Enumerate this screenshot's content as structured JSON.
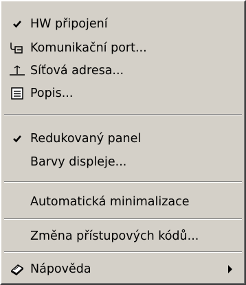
{
  "menu": {
    "items": [
      {
        "label": "HW připojení",
        "checked": true,
        "icon": "check-icon"
      },
      {
        "label": "Komunikační port...",
        "icon": "port-connector-icon"
      },
      {
        "label": "Síťová adresa...",
        "icon": "network-address-icon"
      },
      {
        "label": "Popis...",
        "icon": "description-list-icon"
      },
      {
        "label": "Redukovaný panel",
        "checked": true,
        "icon": "check-icon"
      },
      {
        "label": "Barvy displeje..."
      },
      {
        "label": "Automatická minimalizace"
      },
      {
        "label": "Změna přístupových kódů..."
      },
      {
        "label": "Nápověda",
        "icon": "help-book-icon",
        "submenu": true
      }
    ]
  }
}
